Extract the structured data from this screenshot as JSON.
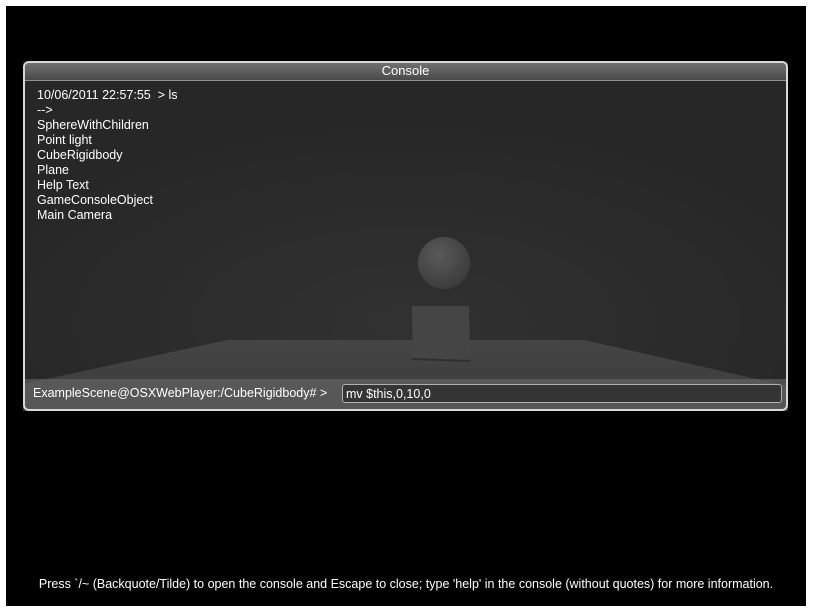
{
  "console": {
    "title": "Console",
    "output": [
      "10/06/2011 22:57:55  > ls",
      "-->",
      "SphereWithChildren",
      "Point light",
      "CubeRigidbody",
      "Plane",
      "Help Text",
      "GameConsoleObject",
      "Main Camera"
    ],
    "prompt": "ExampleScene@OSXWebPlayer:/CubeRigidbody# >",
    "command_value": "mv $this,0,10,0"
  },
  "help_text": "Press `/~ (Backquote/Tilde) to open the console and Escape to close; type 'help' in the console (without quotes) for more information.",
  "colors": {
    "background": "#000000",
    "console_text": "#ffffff",
    "console_border": "#d8d8d8"
  }
}
